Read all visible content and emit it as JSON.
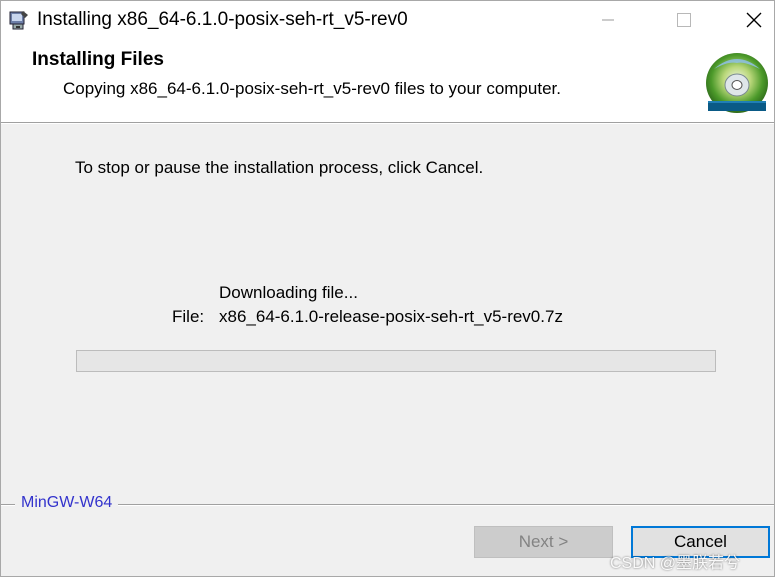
{
  "window": {
    "title": "Installing x86_64-6.1.0-posix-seh-rt_v5-rev0",
    "controls": {
      "minimize": "minimize",
      "maximize": "maximize",
      "close": "close"
    }
  },
  "banner": {
    "title": "Installing Files",
    "subtitle": "Copying x86_64-6.1.0-posix-seh-rt_v5-rev0 files to your computer."
  },
  "body": {
    "instruction": "To stop or pause the installation process, click Cancel.",
    "status": "Downloading file...",
    "file_label": "File:",
    "file_name": "x86_64-6.1.0-release-posix-seh-rt_v5-rev0.7z",
    "progress_fraction": 0.0
  },
  "footer": {
    "brand": "MinGW-W64",
    "next_label": "Next >",
    "cancel_label": "Cancel"
  },
  "watermark": "CSDN @墨朕若兮",
  "colors": {
    "brand": "#3333cc",
    "focus_border": "#0078d7",
    "progress": "#06b025"
  },
  "icons": {
    "app": "installer-icon",
    "banner": "cd-disc-icon"
  }
}
